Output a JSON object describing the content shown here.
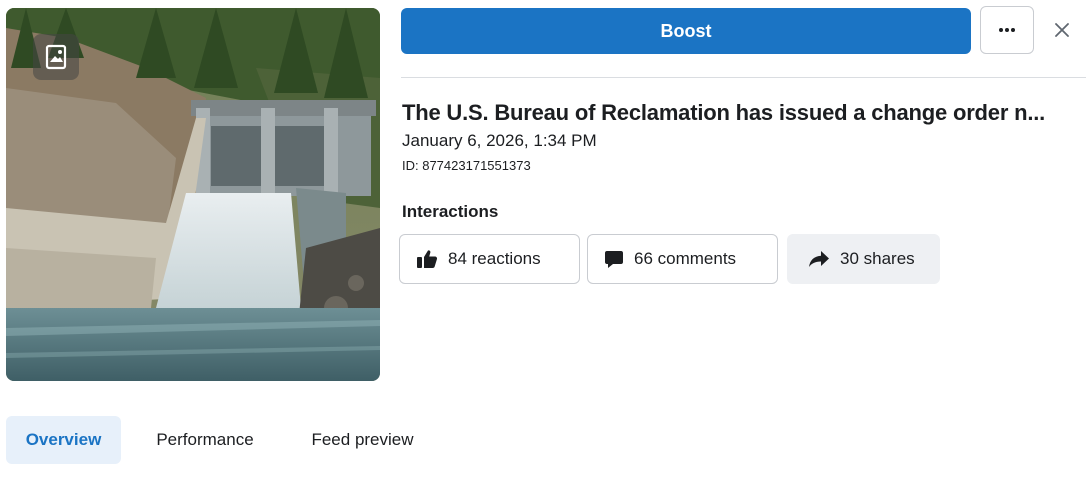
{
  "header": {
    "boost_label": "Boost",
    "more_icon": "ellipsis-icon",
    "close_icon": "close-icon"
  },
  "post": {
    "title": "The U.S. Bureau of Reclamation has issued a change order n...",
    "date": "January 6, 2026, 1:34 PM",
    "id": "ID: 877423171551373"
  },
  "interactions": {
    "heading": "Interactions",
    "reactions": "84 reactions",
    "comments": "66 comments",
    "shares": "30 shares"
  },
  "tabs": [
    {
      "label": "Overview",
      "active": true
    },
    {
      "label": "Performance",
      "active": false
    },
    {
      "label": "Feed preview",
      "active": false
    }
  ],
  "colors": {
    "accent": "#1b74c4",
    "active_tab_bg": "#e7f0fa"
  }
}
